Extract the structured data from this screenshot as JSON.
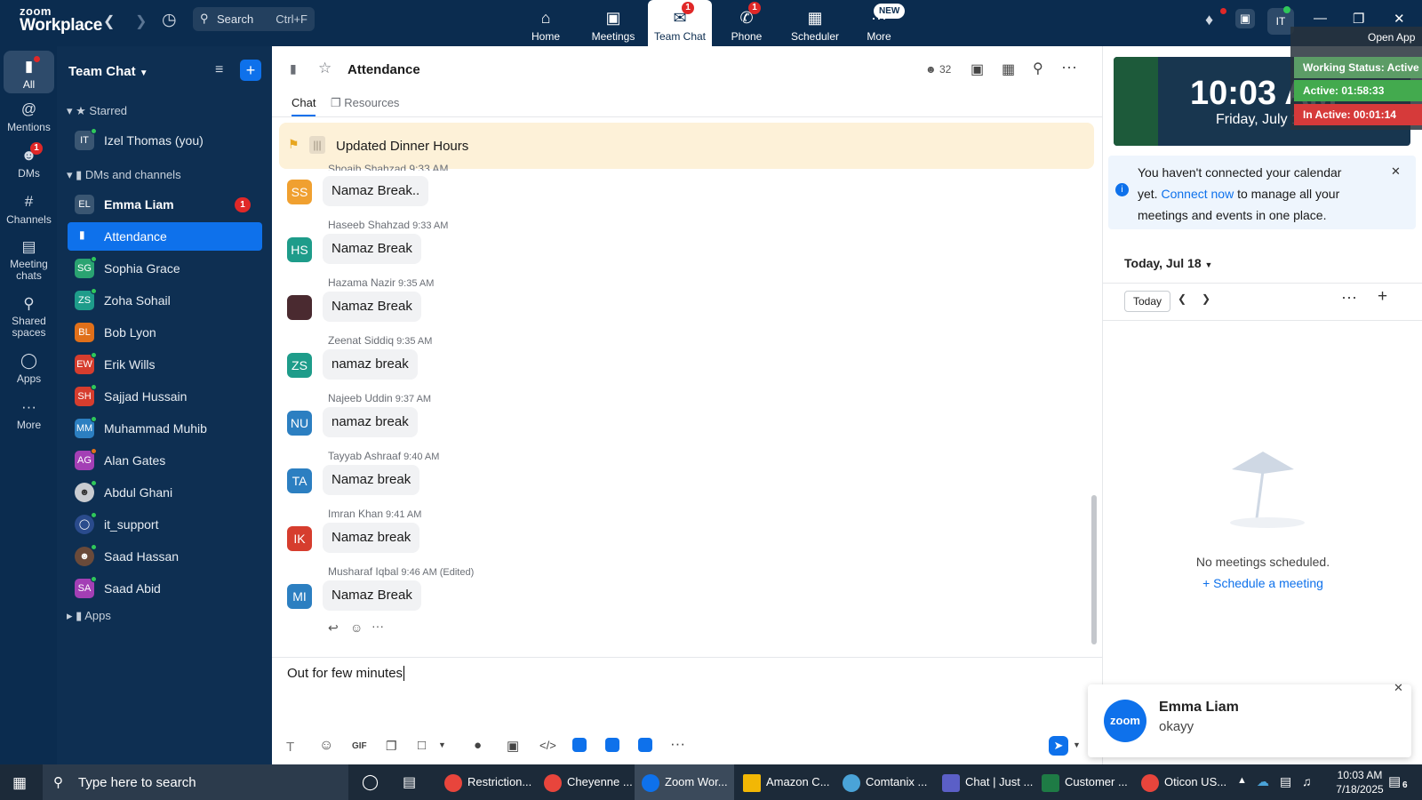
{
  "app": {
    "brand_small": "zoom",
    "brand_large": "Workplace",
    "accent": "#0e71eb",
    "nav_bg": "#0b2c4f"
  },
  "topbar": {
    "search_label": "Search",
    "search_shortcut": "Ctrl+F",
    "tabs": [
      {
        "label": "Home",
        "icon": "home-icon",
        "badge": ""
      },
      {
        "label": "Meetings",
        "icon": "video-camera-icon",
        "badge": ""
      },
      {
        "label": "Team Chat",
        "icon": "chat-bubble-icon",
        "badge": "1"
      },
      {
        "label": "Phone",
        "icon": "phone-icon",
        "badge": "1"
      },
      {
        "label": "Scheduler",
        "icon": "calendar-icon",
        "badge": ""
      },
      {
        "label": "More",
        "icon": "more-dots-icon",
        "badge": "NEW"
      }
    ],
    "user_initials": "IT"
  },
  "overlay": {
    "open_app": "Open App",
    "working_status": "Working Status: Active",
    "active_time": "Active: 01:58:33",
    "inactive_time": "In Active: 00:01:14",
    "clock_time": "10:03 AM",
    "clock_date": "Friday, July 18"
  },
  "rail": [
    {
      "label": "All",
      "icon": "chat-icon",
      "badge": ""
    },
    {
      "label": "Mentions",
      "icon": "at-icon",
      "badge": ""
    },
    {
      "label": "DMs",
      "icon": "people-icon",
      "badge": "1"
    },
    {
      "label": "Channels",
      "icon": "hash-icon",
      "badge": ""
    },
    {
      "label": "Meeting chats",
      "icon": "meeting-chat-icon",
      "badge": ""
    },
    {
      "label": "Shared spaces",
      "icon": "shared-spaces-icon",
      "badge": ""
    },
    {
      "label": "Apps",
      "icon": "apps-icon",
      "badge": ""
    },
    {
      "label": "More",
      "icon": "more-icon",
      "badge": ""
    }
  ],
  "sidebar": {
    "title": "Team Chat",
    "starred_label": "Starred",
    "starred": [
      {
        "initials": "IT",
        "name": "Izel Thomas (you)",
        "color": "#3a5672"
      }
    ],
    "dms_label": "DMs and channels",
    "items": [
      {
        "initials": "EL",
        "name": "Emma Liam",
        "color": "#3a5672",
        "bold": true,
        "badge": "1"
      },
      {
        "initials": "",
        "name": "Attendance",
        "color": "",
        "selected": true
      },
      {
        "initials": "SG",
        "name": "Sophia Grace",
        "color": "#2aa371"
      },
      {
        "initials": "ZS",
        "name": "Zoha Sohail",
        "color": "#1e9c8a"
      },
      {
        "initials": "BL",
        "name": "Bob Lyon",
        "color": "#e0701a"
      },
      {
        "initials": "EW",
        "name": "Erik Wills",
        "color": "#d63d2e"
      },
      {
        "initials": "SH",
        "name": "Sajjad Hussain",
        "color": "#d63d2e"
      },
      {
        "initials": "MM",
        "name": "Muhammad Muhib",
        "color": "#2c7fc1"
      },
      {
        "initials": "AG",
        "name": "Alan Gates",
        "color": "#a33fb5"
      },
      {
        "initials": "",
        "name": "Abdul Ghani",
        "color": "#8b8f94"
      },
      {
        "initials": "",
        "name": "it_support",
        "color": "#2a4b8c"
      },
      {
        "initials": "",
        "name": "Saad Hassan",
        "color": "#6a4a3a"
      },
      {
        "initials": "SA",
        "name": "Saad Abid",
        "color": "#a33fb5"
      }
    ],
    "apps_label": "Apps"
  },
  "channel": {
    "name": "Attendance",
    "member_count": "32",
    "tabs": [
      "Chat",
      "Resources"
    ],
    "pinned": "Updated Dinner Hours",
    "partial_meta": "Shoaib Shahzad 9:33 AM"
  },
  "messages": [
    {
      "initials": "SS",
      "sender": "",
      "time": "",
      "text": "Namaz Break..",
      "color": "#f0a030"
    },
    {
      "initials": "HS",
      "sender": "Haseeb Shahzad",
      "time": "9:33 AM",
      "text": "Namaz Break",
      "color": "#1e9c8a"
    },
    {
      "initials": "",
      "sender": "Hazama Nazir",
      "time": "9:35 AM",
      "text": "Namaz Break",
      "color": "#4a2a30"
    },
    {
      "initials": "ZS",
      "sender": "Zeenat Siddiq",
      "time": "9:35 AM",
      "text": "namaz break",
      "color": "#1e9c8a"
    },
    {
      "initials": "NU",
      "sender": "Najeeb Uddin",
      "time": "9:37 AM",
      "text": "namaz break",
      "color": "#2c7fc1"
    },
    {
      "initials": "TA",
      "sender": "Tayyab Ashraaf",
      "time": "9:40 AM",
      "text": "Namaz break",
      "color": "#2c7fc1"
    },
    {
      "initials": "IK",
      "sender": "Imran Khan",
      "time": "9:41 AM",
      "text": "Namaz break",
      "color": "#d63d2e"
    },
    {
      "initials": "MI",
      "sender": "Musharaf Iqbal",
      "time": "9:46 AM",
      "edited": "(Edited)",
      "text": "Namaz Break",
      "color": "#2c7fc1"
    }
  ],
  "composer": {
    "text": "Out for few minutes",
    "gif": "GIF"
  },
  "calendar": {
    "notice_pre": "You haven't connected your calendar yet.",
    "notice_link": "Connect now",
    "notice_post": "to manage all your meetings and events in one place.",
    "date_label": "Today, Jul 18",
    "today_button": "Today",
    "empty_text": "No meetings scheduled.",
    "schedule_link": "Schedule a meeting"
  },
  "notification": {
    "logo": "zoom",
    "title": "Emma Liam",
    "body": "okayy"
  },
  "taskbar": {
    "search_placeholder": "Type here to search",
    "apps": [
      {
        "label": "Restriction...",
        "color": "#e8453c"
      },
      {
        "label": "Cheyenne ...",
        "color": "#e8453c"
      },
      {
        "label": "Zoom Wor...",
        "color": "#0e71eb"
      },
      {
        "label": "Amazon C...",
        "color": "#f2b705"
      },
      {
        "label": "Comtanix ...",
        "color": "#4aa3d8"
      },
      {
        "label": "Chat | Just ...",
        "color": "#5b5fc7"
      },
      {
        "label": "Customer ...",
        "color": "#1e7b45"
      },
      {
        "label": "Oticon US...",
        "color": "#e8453c"
      }
    ],
    "time": "10:03 AM",
    "date": "7/18/2025",
    "notif_count": "6"
  }
}
